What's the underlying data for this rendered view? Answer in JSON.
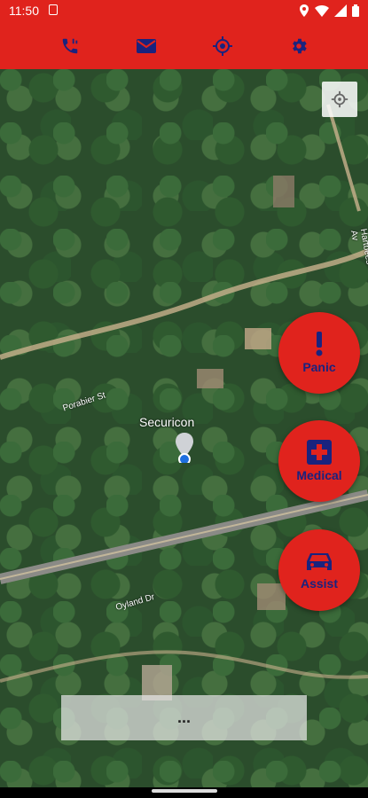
{
  "status_bar": {
    "time": "11:50",
    "icons": [
      "sim-icon",
      "location-icon",
      "wifi-icon",
      "signal-icon",
      "battery-icon"
    ]
  },
  "toolbar": {
    "buttons": [
      "phone-call-icon",
      "mail-icon",
      "gps-target-icon",
      "settings-icon"
    ]
  },
  "map": {
    "place_label": "Securicon",
    "road_labels": [
      "Porabier St",
      "Oyland Dr",
      "Hartbees Av"
    ]
  },
  "actions": {
    "panic": "Panic",
    "medical": "Medical",
    "assist": "Assist"
  },
  "bottom_panel": {
    "text": "..."
  },
  "colors": {
    "brand_red": "#e0231d",
    "icon_blue": "#1a237e"
  }
}
